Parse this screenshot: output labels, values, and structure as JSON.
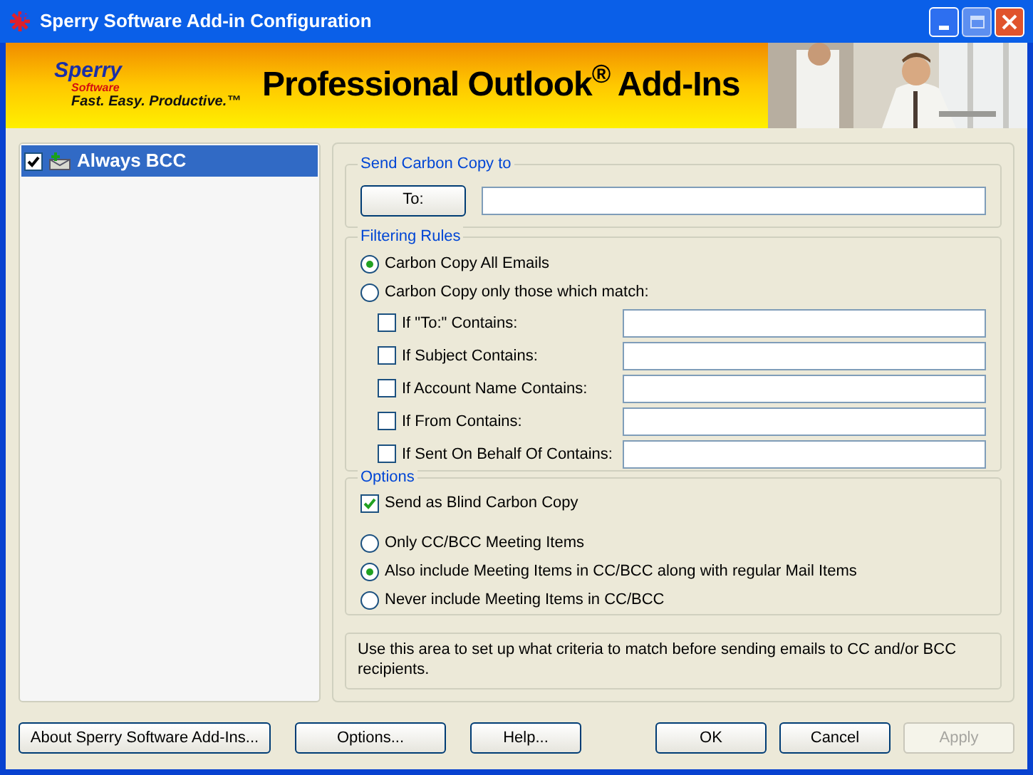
{
  "window": {
    "title": "Sperry Software Add-in Configuration"
  },
  "banner": {
    "logo_name": "Sperry",
    "logo_sub": "Software",
    "tagline": "Fast. Easy. Productive.™",
    "headline": "Professional Outlook$^{®}$ Add-Ins"
  },
  "addins": [
    {
      "label": "Always BCC",
      "checked": true,
      "selected": true
    }
  ],
  "send_cc": {
    "title": "Send Carbon Copy to",
    "button": "To:"
  },
  "filtering": {
    "title": "Filtering Rules",
    "modes": [
      {
        "label": "Carbon Copy All Emails",
        "selected": true
      },
      {
        "label": "Carbon Copy only those which match:",
        "selected": false
      }
    ],
    "conditions": [
      {
        "label": "If \"To:\" Contains:",
        "checked": false
      },
      {
        "label": "If Subject Contains:",
        "checked": false
      },
      {
        "label": "If Account Name Contains:",
        "checked": false
      },
      {
        "label": "If From Contains:",
        "checked": false
      },
      {
        "label": "If Sent On Behalf Of Contains:",
        "checked": false
      }
    ]
  },
  "options": {
    "title": "Options",
    "blind_copy": {
      "label": "Send as Blind Carbon Copy",
      "checked": true
    },
    "meeting_items": [
      {
        "label": "Only CC/BCC Meeting Items",
        "selected": false
      },
      {
        "label": "Also include Meeting Items in CC/BCC along with regular Mail Items",
        "selected": true
      },
      {
        "label": "Never include Meeting Items in CC/BCC",
        "selected": false
      }
    ]
  },
  "description": "Use this area to set up what criteria to match before sending emails to CC and/or BCC recipients.",
  "buttons": [
    {
      "label": "About Sperry Software Add-Ins...",
      "disabled": false
    },
    {
      "label": "Options...",
      "disabled": false
    },
    {
      "label": "Help...",
      "disabled": false
    },
    {
      "label": "OK",
      "disabled": false
    },
    {
      "label": "Cancel",
      "disabled": false
    },
    {
      "label": "Apply",
      "disabled": true
    }
  ]
}
